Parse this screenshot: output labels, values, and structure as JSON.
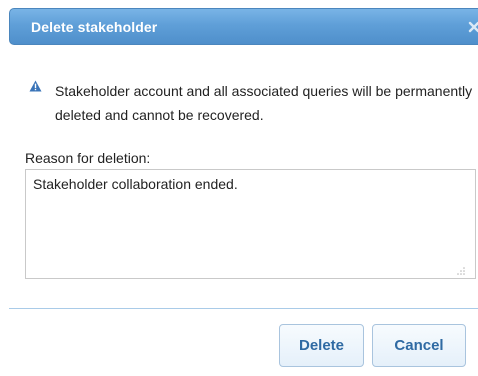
{
  "dialog": {
    "title": "Delete stakeholder",
    "close_icon": "close-icon",
    "warning_icon": "warning-triangle-icon",
    "warning_color": "#3a74b8",
    "message": "Stakeholder account and all associated queries will be permanently deleted and cannot be recovered.",
    "reason_label": "Reason for deletion:",
    "reason_value": "Stakeholder collaboration ended.",
    "buttons": {
      "delete_label": "Delete",
      "cancel_label": "Cancel"
    }
  },
  "colors": {
    "titlebar": "#5f9fd8",
    "button_text": "#2f6aa3"
  }
}
